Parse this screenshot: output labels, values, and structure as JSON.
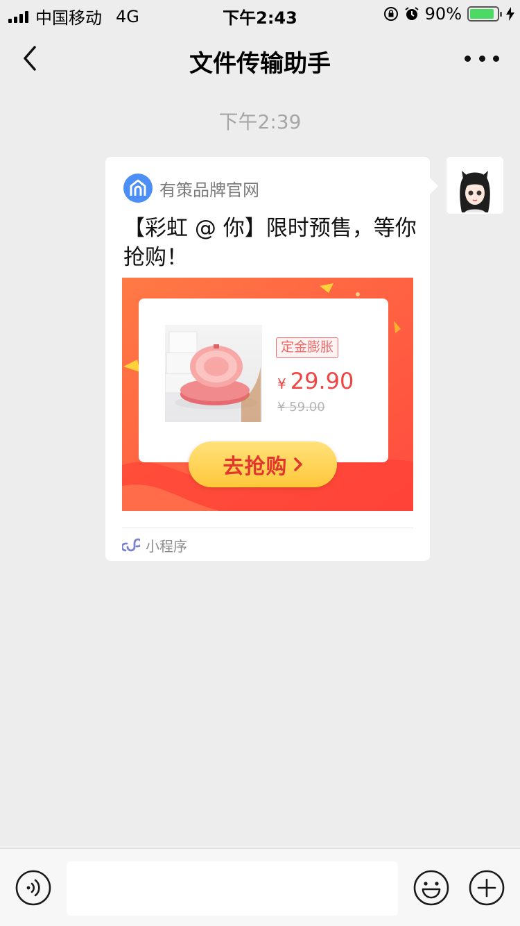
{
  "status_bar": {
    "carrier": "中国移动",
    "network": "4G",
    "time": "下午2:43",
    "battery_percent": "90%",
    "battery_level": 0.9
  },
  "navbar": {
    "title": "文件传输助手"
  },
  "chat": {
    "timestamp": "下午2:39"
  },
  "message": {
    "source_name": "有策品牌官网",
    "title": "【彩虹 @ 你】限时预售，等你抢购！",
    "banner": {
      "tag": "定金膨胀",
      "currency": "¥",
      "price": "29.90",
      "old_price": "¥ 59.00",
      "cta_label": "去抢购",
      "cta_arrow": "›"
    },
    "footer_label": "小程序"
  },
  "colors": {
    "accent_red": "#f04545",
    "banner_red": "#ff5a3c",
    "cta_yellow": "#ffc73a",
    "logo_blue": "#4b8ef5",
    "battery_green": "#4cd964"
  }
}
